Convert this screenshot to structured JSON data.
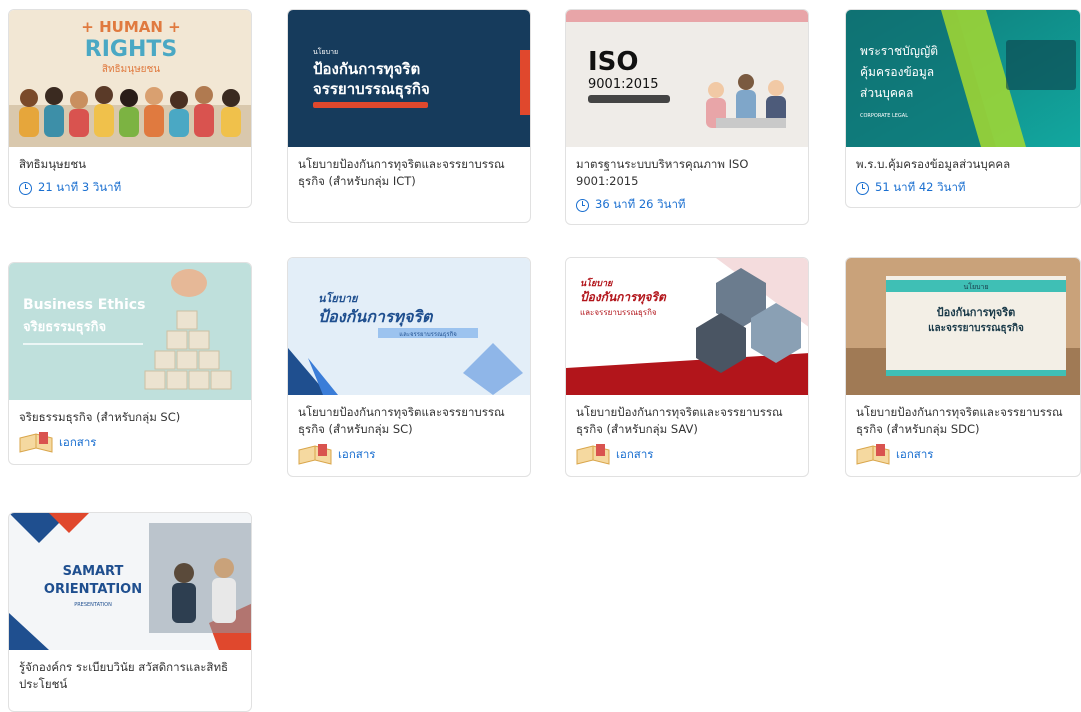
{
  "courses": [
    {
      "title": "สิทธิมนุษยชน",
      "meta": "21 นาที 3 วินาที",
      "meta_type": "duration",
      "thumb": {
        "line1": "+ HUMAN +",
        "line2": "RIGHTS",
        "line3": "สิทธิมนุษยชน"
      }
    },
    {
      "title": "นโยบายป้องกันการทุจริตและจรรยาบรรณธุรกิจ (สำหรับกลุ่ม ICT)",
      "meta": "",
      "meta_type": "none",
      "thumb": {
        "line1": "นโยบาย",
        "line2": "ป้องกันการทุจริต",
        "line3": "จรรยาบรรณธุรกิจ"
      }
    },
    {
      "title": "มาตรฐานระบบบริหารคุณภาพ ISO 9001:2015",
      "meta": "36 นาที 26 วินาที",
      "meta_type": "duration",
      "thumb": {
        "line1": "ISO",
        "line2": "9001:2015"
      }
    },
    {
      "title": "พ.ร.บ.คุ้มครองข้อมูลส่วนบุคคล",
      "meta": "51 นาที 42 วินาที",
      "meta_type": "duration",
      "thumb": {
        "line1": "พระราชบัญญัติ",
        "line2": "คุ้มครองข้อมูล",
        "line3": "ส่วนบุคคล",
        "badge": "CORPORATE LEGAL"
      }
    },
    {
      "title": "จริยธรรมธุรกิจ (สำหรับกลุ่ม SC)",
      "meta": "เอกสาร",
      "meta_type": "document",
      "thumb": {
        "line1": "Business Ethics",
        "line2": "จริยธรรมธุรกิจ"
      }
    },
    {
      "title": "นโยบายป้องกันการทุจริตและจรรยาบรรณธุรกิจ (สำหรับกลุ่ม SC)",
      "meta": "เอกสาร",
      "meta_type": "document",
      "thumb": {
        "line1": "นโยบาย",
        "line2": "ป้องกันการทุจริต",
        "line3": "และจรรยาบรรณธุรกิจ"
      }
    },
    {
      "title": "นโยบายป้องกันการทุจริตและจรรยาบรรณธุรกิจ (สำหรับกลุ่ม SAV)",
      "meta": "เอกสาร",
      "meta_type": "document",
      "thumb": {
        "line1": "นโยบาย",
        "line2": "ป้องกันการทุจริต",
        "line3": "และจรรยาบรรณธุรกิจ"
      }
    },
    {
      "title": "นโยบายป้องกันการทุจริตและจรรยาบรรณธุรกิจ (สำหรับกลุ่ม SDC)",
      "meta": "เอกสาร",
      "meta_type": "document",
      "thumb": {
        "line1": "นโยบาย",
        "line2": "ป้องกันการทุจริต",
        "line3": "และจรรยาบรรณธุรกิจ"
      }
    },
    {
      "title": "รู้จักองค์กร ระเบียบวินัย สวัสดิการและสิทธิประโยชน์",
      "meta": "",
      "meta_type": "none",
      "thumb": {
        "line1": "SAMART",
        "line2": "ORIENTATION",
        "line3": "PRESENTATION"
      }
    }
  ],
  "colors": {
    "accent": "#1a6fd0",
    "border": "#e1e1e1"
  }
}
